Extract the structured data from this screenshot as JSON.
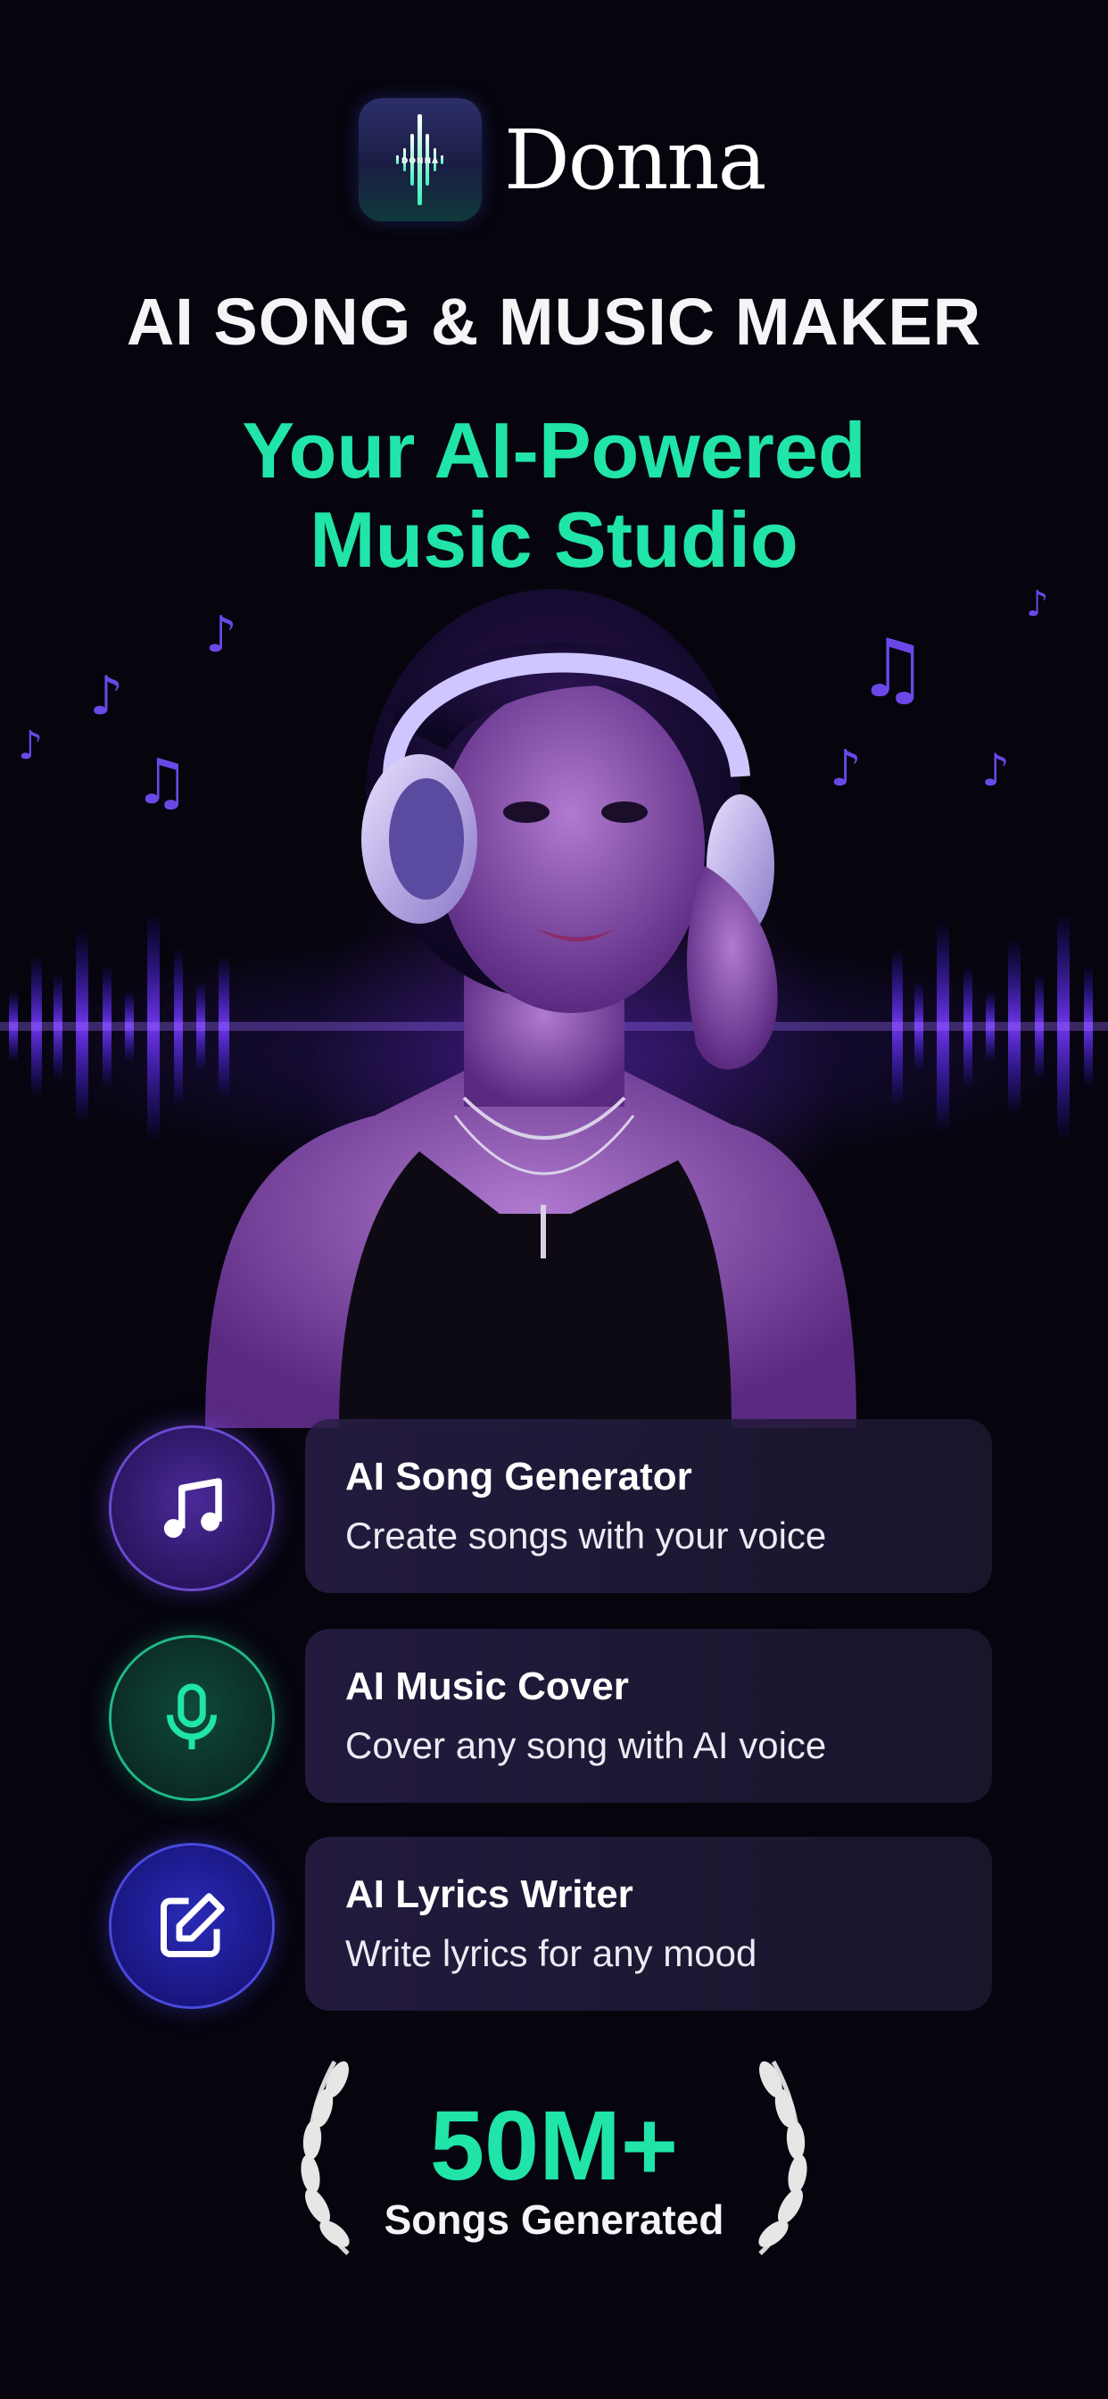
{
  "brand": {
    "name": "Donna",
    "logo_icon": "waveform-logo-icon",
    "logo_text": "DONNA"
  },
  "headline": "AI SONG & MUSIC MAKER",
  "subheadline": [
    "Your AI-Powered",
    "Music Studio"
  ],
  "features": [
    {
      "icon": "music-note-icon",
      "title": "AI Song Generator",
      "description": "Create songs with your voice",
      "accent": "#6a4ad0"
    },
    {
      "icon": "microphone-icon",
      "title": "AI Music Cover",
      "description": "Cover any song with AI voice",
      "accent": "#1fb888"
    },
    {
      "icon": "edit-pencil-icon",
      "title": "AI Lyrics Writer",
      "description": "Write lyrics for any mood",
      "accent": "#4a4ae0"
    }
  ],
  "stat": {
    "value": "50M+",
    "label": "Songs Generated"
  },
  "colors": {
    "accent_green": "#20e4a8",
    "background": "#06040d",
    "purple_glow": "#7a3cff"
  }
}
